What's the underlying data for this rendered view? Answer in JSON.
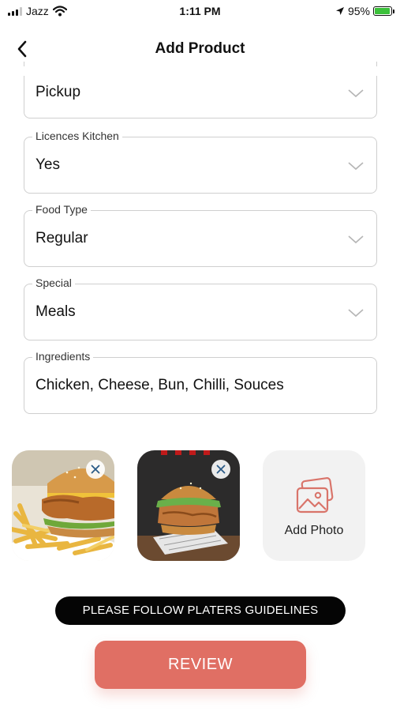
{
  "status_bar": {
    "carrier": "Jazz",
    "time": "1:11 PM",
    "battery": "95%",
    "battery_fraction": 0.95
  },
  "header": {
    "title": "Add Product"
  },
  "form": {
    "fields": [
      {
        "label": "",
        "value": "Pickup"
      },
      {
        "label": "Licences Kitchen",
        "value": "Yes"
      },
      {
        "label": "Food Type",
        "value": "Regular"
      },
      {
        "label": "Special",
        "value": "Meals"
      },
      {
        "label": "Ingredients",
        "value": "Chicken, Cheese, Bun, Chilli, Souces"
      }
    ]
  },
  "photos": {
    "items": [
      {
        "description": "fried chicken burger with fries"
      },
      {
        "description": "fried chicken burger on dark background"
      }
    ],
    "add_label": "Add Photo"
  },
  "actions": {
    "guidelines_label": "PLEASE FOLLOW PLATERS GUIDELINES",
    "review_label": "REVIEW"
  },
  "colors": {
    "accent": "#e06f64",
    "guidelines_bg": "#050505",
    "battery_fill": "#3cc13b"
  }
}
